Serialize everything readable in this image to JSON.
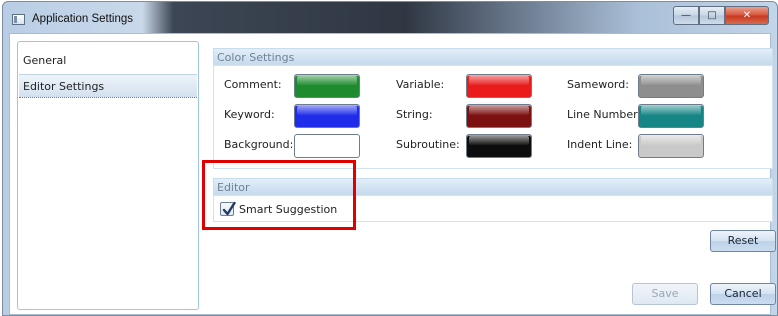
{
  "window": {
    "title": "Application Settings",
    "caption_buttons": [
      "minimize",
      "maximize",
      "close"
    ]
  },
  "nav": {
    "items": [
      {
        "label": "General",
        "selected": false
      },
      {
        "label": "Editor Settings",
        "selected": true
      }
    ]
  },
  "color_settings": {
    "header": "Color Settings",
    "rows": [
      [
        {
          "label": "Comment:",
          "color": "#1e8c2e"
        },
        {
          "label": "Variable:",
          "color": "#ea1b1b"
        },
        {
          "label": "Sameword:",
          "color": "#8e8e8e"
        }
      ],
      [
        {
          "label": "Keyword:",
          "color": "#1f2dea"
        },
        {
          "label": "String:",
          "color": "#7d1010"
        },
        {
          "label": "Line Number:",
          "color": "#168585"
        }
      ],
      [
        {
          "label": "Background:",
          "color": "#ffffff"
        },
        {
          "label": "Subroutine:",
          "color": "#0d0d0d"
        },
        {
          "label": "Indent Line:",
          "color": "#c9c9c9"
        }
      ]
    ]
  },
  "editor": {
    "header": "Editor",
    "smart_suggestion": {
      "label": "Smart Suggestion",
      "checked": true
    }
  },
  "buttons": {
    "reset": "Reset",
    "save": "Save",
    "cancel": "Cancel"
  },
  "annotation": {
    "color": "#e00000"
  }
}
